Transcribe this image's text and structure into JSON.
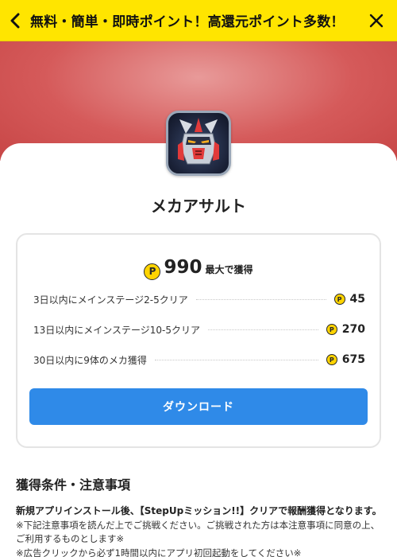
{
  "topbar": {
    "title": "無料・簡単・即時ポイント！高還元ポイント多数！",
    "background": "#ffe500",
    "back_icon": "chevron-left-icon",
    "close_icon": "close-icon"
  },
  "hero": {
    "background_color": "#d55a5a"
  },
  "app": {
    "name": "メカアサルト",
    "icon": "robot-mech-app-icon"
  },
  "reward": {
    "coin_label": "P",
    "total": "990",
    "total_suffix": "最大で獲得",
    "missions": [
      {
        "text": "3日以内にメインステージ2-5クリア",
        "points": "45"
      },
      {
        "text": "13日以内にメインステージ10-5クリア",
        "points": "270"
      },
      {
        "text": "30日以内に9体のメカ獲得",
        "points": "675"
      }
    ],
    "download_label": "ダウンロード",
    "download_color": "#2f8ae8",
    "coin_color": "#ffd400"
  },
  "terms": {
    "heading": "獲得条件・注意事項",
    "lead": "新規アプリインストール後、【StepUpミッション!!】クリアで報酬獲得となります。",
    "notes": [
      "※下記注意事項を読んだ上でご挑戦ください。ご挑戦された方は本注意事項に同意の上、ご利用するものとします※",
      "※広告クリックから必ず1時間以内にアプリ初回起動をしてください※"
    ]
  }
}
